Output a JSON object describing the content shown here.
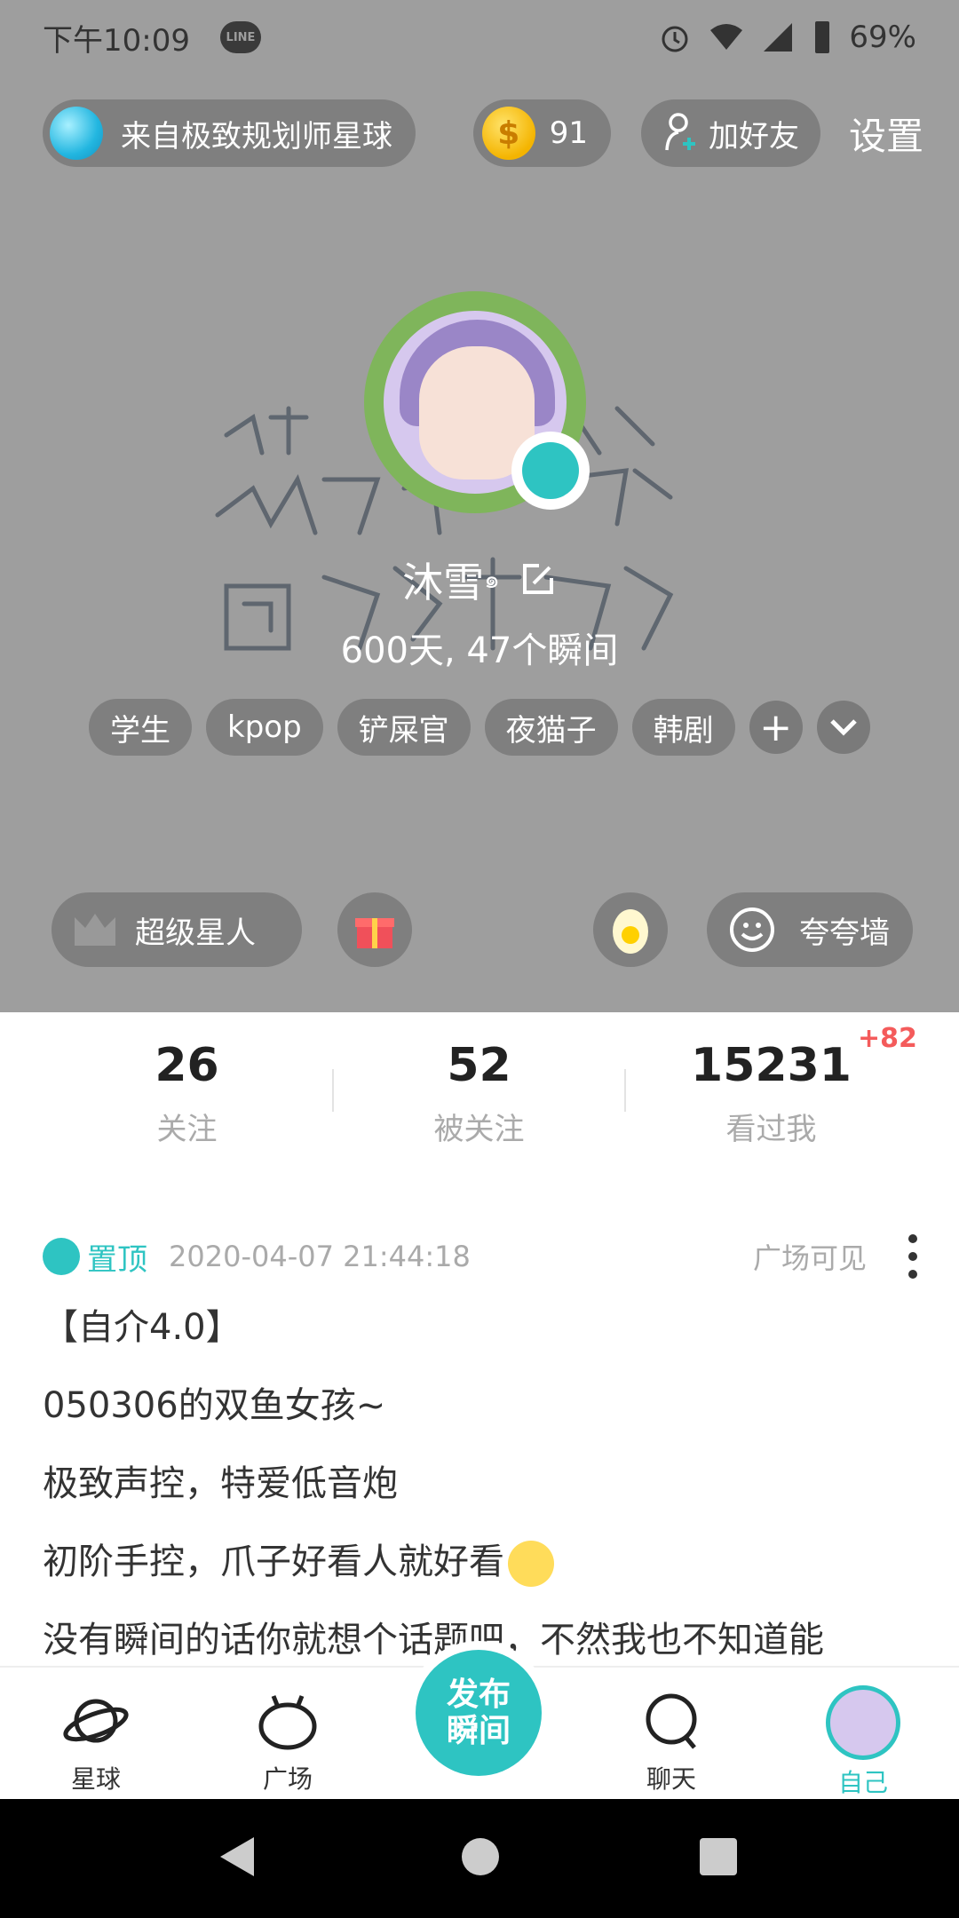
{
  "status_bar": {
    "time": "下午10:09",
    "line_label": "LINE",
    "battery": "69%"
  },
  "top_bar": {
    "planet": "来自极致规划师星球",
    "coins": "91",
    "coin_symbol": "$",
    "add_friend": "加好友",
    "settings": "设置"
  },
  "profile": {
    "nickname": "沐雪",
    "nickname_mark": "๑",
    "stats_line": "600天, 47个瞬间",
    "tags": [
      "学生",
      "kpop",
      "铲屎官",
      "夜猫子",
      "韩剧"
    ],
    "add_tag": "+"
  },
  "actions": {
    "super": "超级星人",
    "praise_wall": "夸夸墙"
  },
  "stats": {
    "following": {
      "value": "26",
      "label": "关注"
    },
    "followers": {
      "value": "52",
      "label": "被关注"
    },
    "viewed": {
      "value": "15231",
      "label": "看过我",
      "delta": "+82"
    }
  },
  "post": {
    "pinned": "置顶",
    "time": "2020-04-07 21:44:18",
    "visibility": "广场可见",
    "lines": [
      "【自介4.0】",
      "050306的双鱼女孩~",
      "极致声控，特爱低音炮",
      "初阶手控，爪子好看人就好看",
      "没有瞬间的话你就想个话题吧，不然我也不知道能"
    ]
  },
  "bottom_nav": {
    "planet": "星球",
    "square": "广场",
    "publish": "发布\n瞬间",
    "chat": "聊天",
    "me": "自己"
  },
  "colors": {
    "accent": "#2ec4c2",
    "header_bg": "#9e9e9e",
    "delta": "#f45b5b"
  }
}
